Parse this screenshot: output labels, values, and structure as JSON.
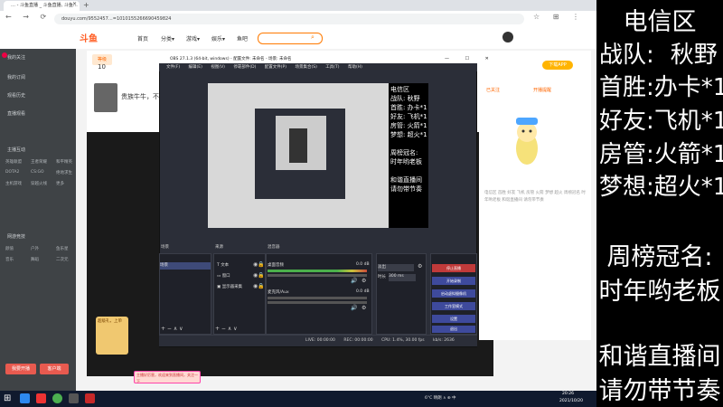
{
  "browser": {
    "tab_title": "… - 斗鱼直播 _ 斗鱼直播, 斗鱼…",
    "url": "douyu.com/9552457…=1010155266690459824",
    "nav_icons": "← → ⟳ ⌂",
    "addr_icons": "☆ ⊞ ⋮",
    "window_controls": "— ☐ ✕"
  },
  "site": {
    "logo": "斗鱼",
    "nav": [
      "首页",
      "分类▾",
      "游戏▾",
      "娱乐▾",
      "鱼吧"
    ],
    "search_icon": "search-icon"
  },
  "sidebar": {
    "items": [
      "我的关注",
      "我的订阅",
      "观看历史",
      "直播观看",
      "主播互动",
      "网游竞技"
    ],
    "grid_a": [
      "英雄联盟",
      "王者荣耀",
      "和平精英",
      "DOTA2",
      "CS:GO",
      "绝地求生",
      "主机游戏",
      "穿越火线",
      "更多"
    ],
    "grid_b": [
      "颜值",
      "户外",
      "鱼乐星",
      "音乐",
      "舞蹈",
      "二次元"
    ],
    "btn1": "我要开播",
    "btn2": "客户端"
  },
  "room": {
    "level_label": "等级",
    "level_value": "10",
    "streamer_line": "贵族牛牛，不…"
  },
  "right_panel": {
    "button": "下载APP",
    "hot_a": "已关注",
    "hot_b": "开播提醒",
    "text": "电信区 首胜 好友 飞机 房管 火箭 梦想 超火 周榜冠名 时年哟老板 和谐直播间 请勿带节奏"
  },
  "gift": {
    "label": "超级礼，上单"
  },
  "danmu": {
    "text": "主播好厉害，欢迎来到直播间，关注一下"
  },
  "obs": {
    "title": "OBS 27.1.3 (64-bit, windows) - 配置文件: 未命名 - 场景: 未命名",
    "menu": [
      "文件(F)",
      "编辑(E)",
      "视图(V)",
      "停靠部件(D)",
      "配置文件(P)",
      "场景集合(S)",
      "工具(T)",
      "帮助(H)"
    ],
    "window_controls": "— ☐ ✕",
    "overlay_lines": [
      "电信区",
      "战队: 秋野",
      "首胜: 办卡*1",
      "好友: 飞机*1",
      "房管: 火箭*1",
      "梦想: 超火*1",
      "",
      "周榜冠名:",
      "时年哟老板",
      "",
      "和谐直播间",
      "请勿带节奏"
    ],
    "docks": {
      "scenes_header": "场景",
      "sources_header": "来源",
      "mixer_header": "混音器",
      "trans_header": "场景过渡",
      "controls_header": "控件"
    },
    "scene_items": [
      "场景"
    ],
    "source_items": [
      "文本",
      "窗口",
      "显示器采集"
    ],
    "mixer": [
      {
        "name": "桌面音频",
        "db": "0.0 dB"
      },
      {
        "name": "麦克风/Aux",
        "db": "0.0 dB"
      }
    ],
    "transition": {
      "value": "淡出",
      "duration_label": "时长",
      "duration_value": "300 ms"
    },
    "controls": [
      "停止直播",
      "开始录制",
      "启动虚拟摄像机",
      "工作室模式",
      "设置",
      "退出"
    ],
    "status": {
      "live": "LIVE: 00:00:00",
      "rec": "REC: 00:00:00",
      "cpu": "CPU: 1.4%, 30.00 fps",
      "kbps": "kb/s: 2636"
    },
    "bottom_icons": "+ − ∧ ∨"
  },
  "taskbar": {
    "tray": "6°C 晴朗  ∧ ⊕ 中",
    "time": "20:26",
    "date": "2021/10/20"
  },
  "overlay": {
    "title": "电信区",
    "rows": [
      {
        "label": "战队:",
        "value": "秋野"
      },
      {
        "label": "首胜:",
        "value": "办卡*1"
      },
      {
        "label": "好友:",
        "value": "飞机*1"
      },
      {
        "label": "房管:",
        "value": "火箭*1"
      },
      {
        "label": "梦想:",
        "value": "超火*1"
      }
    ],
    "weekly_label": "周榜冠名:",
    "weekly_value": "时年哟老板",
    "notice_1": "和谐直播间",
    "notice_2": "请勿带节奏"
  }
}
